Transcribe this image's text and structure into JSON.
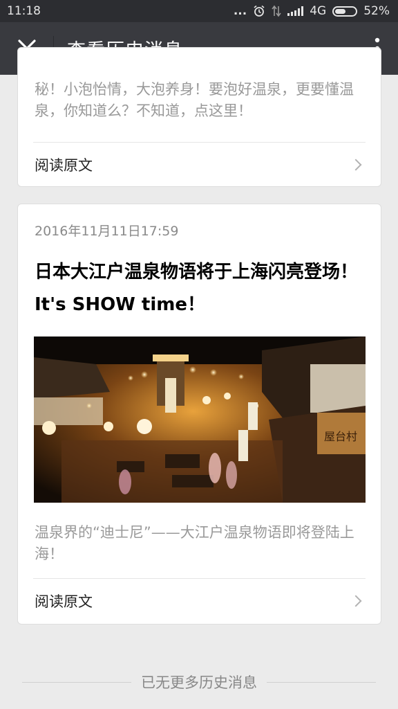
{
  "status_bar": {
    "time": "11:18",
    "dots": "...",
    "network": "4G",
    "battery_text": "52%",
    "battery_level": 0.52
  },
  "title_bar": {
    "title": "查看历史消息"
  },
  "articles": [
    {
      "summary_partial": "秘！小泡怡情，大泡养身！要泡好温泉，更要懂温泉，你知道么？不知道，点这里！",
      "read_more": "阅读原文"
    },
    {
      "date": "2016年11月11日17:59",
      "title": "日本大江户温泉物语将于上海闪亮登场！It's SHOW time！",
      "summary": "温泉界的“迪士尼”——大江户温泉物语即将登陆上海！",
      "read_more": "阅读原文",
      "sign_text": "屋台村"
    }
  ],
  "footer": {
    "end_text": "已无更多历史消息"
  },
  "icons": {
    "close": "close-icon",
    "more": "more-vertical-icon",
    "chevron": "chevron-right-icon"
  },
  "colors": {
    "header_bg": "#393a3f",
    "status_bg": "#2c2d31",
    "page_bg": "#ebebeb"
  }
}
